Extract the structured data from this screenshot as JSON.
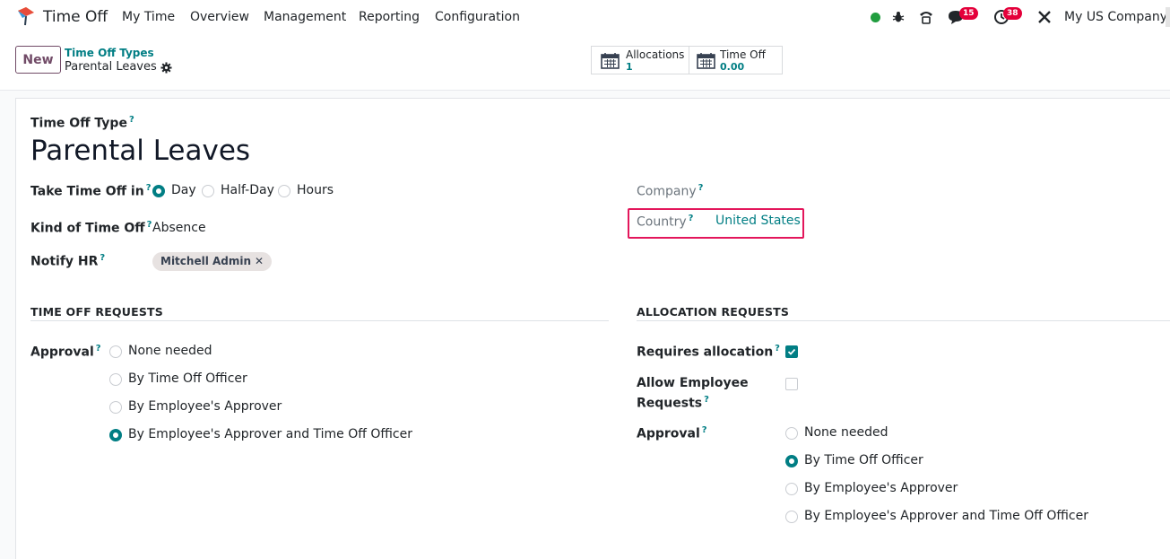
{
  "topbar": {
    "app_name": "Time Off",
    "menu": [
      "My Time",
      "Overview",
      "Management",
      "Reporting",
      "Configuration"
    ],
    "messages_count": "15",
    "activities_count": "38",
    "company": "My US Company",
    "icons": [
      "app-logo-icon",
      "status-dot-icon",
      "bug-icon",
      "phone-icon",
      "chat-icon",
      "clock-icon",
      "tools-icon"
    ],
    "status_color": "#219d3f"
  },
  "control": {
    "new_label": "New",
    "breadcrumb_parent": "Time Off Types",
    "breadcrumb_current": "Parental Leaves",
    "smart_buttons": [
      {
        "label": "Allocations",
        "value": "1"
      },
      {
        "label": "Time Off",
        "value": "0.00"
      }
    ]
  },
  "form": {
    "type_label": "Time Off Type",
    "name": "Parental Leaves",
    "take_in_label": "Take Time Off in",
    "take_in_options": [
      "Day",
      "Half-Day",
      "Hours"
    ],
    "take_in_selected": "Day",
    "kind_label": "Kind of Time Off",
    "kind_value": "Absence",
    "notify_label": "Notify HR",
    "notify_tag": "Mitchell Admin",
    "company_label": "Company",
    "country_label": "Country",
    "country_value": "United States",
    "time_off_section": "TIME OFF REQUESTS",
    "approval_label": "Approval",
    "approval_options": [
      "None needed",
      "By Time Off Officer",
      "By Employee's Approver",
      "By Employee's Approver and Time Off Officer"
    ],
    "approval_selected": "By Employee's Approver and Time Off Officer",
    "alloc_section": "ALLOCATION REQUESTS",
    "requires_alloc_label": "Requires allocation",
    "requires_alloc_checked": true,
    "allow_emp_label_1": "Allow Employee",
    "allow_emp_label_2": "Requests",
    "allow_emp_checked": false,
    "alloc_approval_label": "Approval",
    "alloc_approval_options": [
      "None needed",
      "By Time Off Officer",
      "By Employee's Approver",
      "By Employee's Approver and Time Off Officer"
    ],
    "alloc_approval_selected": "By Time Off Officer"
  },
  "colors": {
    "primary": "#714b67",
    "accent": "#017e84",
    "highlight": "#e3165b",
    "badge": "#e4003a"
  }
}
